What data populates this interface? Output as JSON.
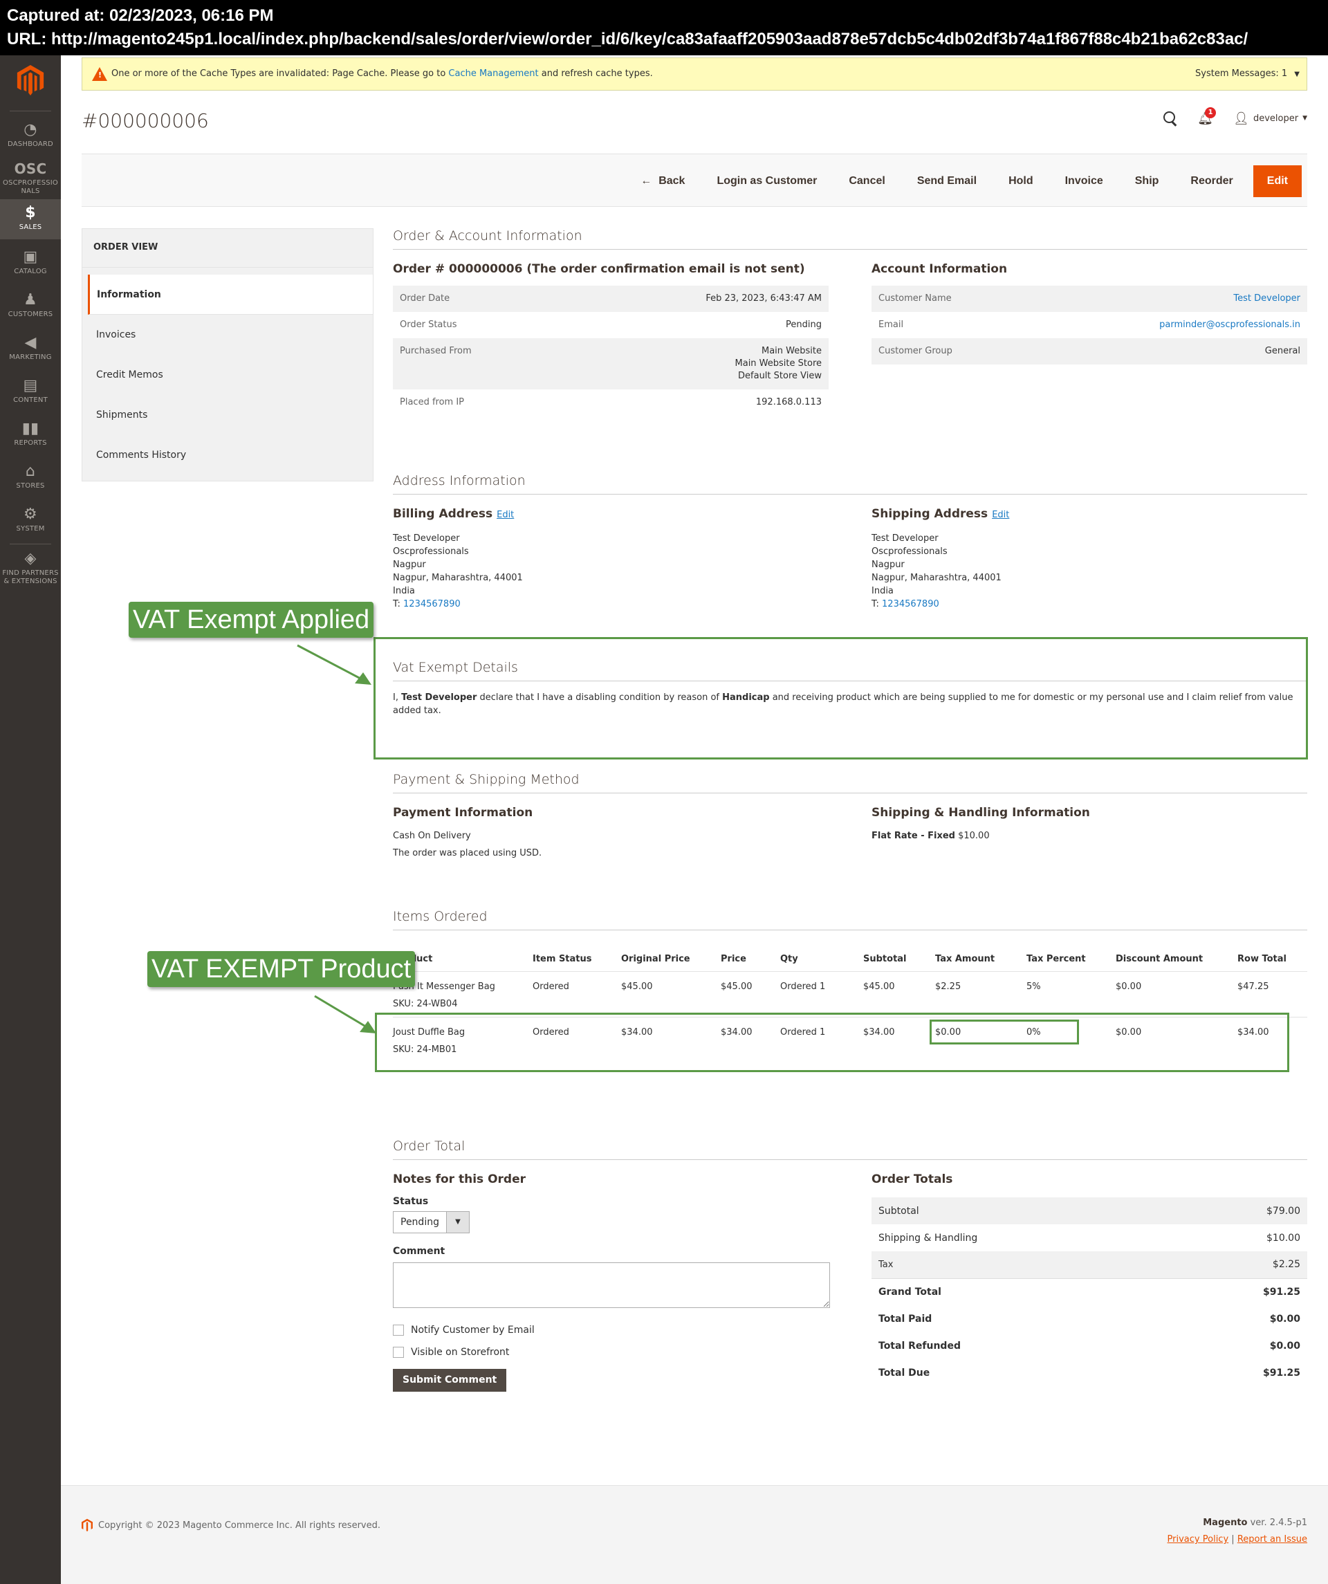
{
  "capture": {
    "captured_at": "Captured at: 02/23/2023, 06:16 PM",
    "url": "URL: http://magento245p1.local/index.php/backend/sales/order/view/order_id/6/key/ca83afaaff205903aad878e57dcb5c4db02df3b74a1f867f88c4b21ba62c83ac/"
  },
  "sidebar": {
    "items": [
      {
        "label": "DASHBOARD",
        "icon": "dashboard-icon"
      },
      {
        "label": "OSCPROFESSIO NALS",
        "icon": "osc-logo-icon"
      },
      {
        "label": "SALES",
        "icon": "dollar-icon",
        "active": true
      },
      {
        "label": "CATALOG",
        "icon": "box-icon"
      },
      {
        "label": "CUSTOMERS",
        "icon": "person-icon"
      },
      {
        "label": "MARKETING",
        "icon": "megaphone-icon"
      },
      {
        "label": "CONTENT",
        "icon": "layout-icon"
      },
      {
        "label": "REPORTS",
        "icon": "bar-chart-icon"
      },
      {
        "label": "STORES",
        "icon": "store-icon"
      },
      {
        "label": "SYSTEM",
        "icon": "gear-icon"
      },
      {
        "label": "FIND PARTNERS & EXTENSIONS",
        "icon": "lego-icon"
      }
    ]
  },
  "notice": {
    "text_before": "One or more of the Cache Types are invalidated: Page Cache. Please go to ",
    "link": "Cache Management",
    "text_after": " and refresh cache types.",
    "system_messages": "System Messages: 1"
  },
  "header": {
    "title": "#000000006",
    "notification_count": "1",
    "user": "developer"
  },
  "actions": {
    "back": "Back",
    "login_as_customer": "Login as Customer",
    "cancel": "Cancel",
    "send_email": "Send Email",
    "hold": "Hold",
    "invoice": "Invoice",
    "ship": "Ship",
    "reorder": "Reorder",
    "edit": "Edit"
  },
  "tabs": {
    "title": "ORDER VIEW",
    "items": [
      "Information",
      "Invoices",
      "Credit Memos",
      "Shipments",
      "Comments History"
    ]
  },
  "order_account": {
    "section_title": "Order & Account Information",
    "order_heading": "Order # 000000006 (The order confirmation email is not sent)",
    "order_rows": [
      {
        "label": "Order Date",
        "value": "Feb 23, 2023, 6:43:47 AM"
      },
      {
        "label": "Order Status",
        "value": "Pending"
      },
      {
        "label": "Purchased From",
        "value": [
          "Main Website",
          "Main Website Store",
          "Default Store View"
        ]
      },
      {
        "label": "Placed from IP",
        "value": "192.168.0.113"
      }
    ],
    "account_heading": "Account Information",
    "account_rows": [
      {
        "label": "Customer Name",
        "value": "Test Developer"
      },
      {
        "label": "Email",
        "value": "parminder@oscprofessionals.in"
      },
      {
        "label": "Customer Group",
        "value": "General"
      }
    ]
  },
  "address": {
    "section_title": "Address Information",
    "edit_label": "Edit",
    "billing": {
      "title": "Billing Address",
      "lines": [
        "Test Developer",
        "Oscprofessionals",
        "Nagpur",
        "Nagpur, Maharashtra, 44001",
        "India"
      ],
      "phone_prefix": "T: ",
      "phone": "1234567890"
    },
    "shipping": {
      "title": "Shipping Address",
      "lines": [
        "Test Developer",
        "Oscprofessionals",
        "Nagpur",
        "Nagpur, Maharashtra, 44001",
        "India"
      ],
      "phone_prefix": "T: ",
      "phone": "1234567890"
    }
  },
  "vat": {
    "section_title": "Vat Exempt Details",
    "text_1": "I, ",
    "name": "Test Developer",
    "text_2": " declare that I have a disabling condition by reason of ",
    "reason": "Handicap",
    "text_3": " and receiving product which are being supplied to me for domestic or my personal use and I claim relief from value added tax."
  },
  "payment_shipping": {
    "section_title": "Payment & Shipping Method",
    "payment_title": "Payment Information",
    "payment_method": "Cash On Delivery",
    "currency_note": "The order was placed using USD.",
    "shipping_title": "Shipping & Handling Information",
    "shipping_method": "Flat Rate - Fixed",
    "shipping_price": "$10.00"
  },
  "items": {
    "section_title": "Items Ordered",
    "columns": [
      "Product",
      "Item Status",
      "Original Price",
      "Price",
      "Qty",
      "Subtotal",
      "Tax Amount",
      "Tax Percent",
      "Discount Amount",
      "Row Total"
    ],
    "rows": [
      {
        "product": "Push It Messenger Bag",
        "sku": "SKU: 24-WB04",
        "status": "Ordered",
        "original_price": "$45.00",
        "price": "$45.00",
        "qty": "Ordered 1",
        "subtotal": "$45.00",
        "tax_amount": "$2.25",
        "tax_percent": "5%",
        "discount": "$0.00",
        "row_total": "$47.25"
      },
      {
        "product": "Joust Duffle Bag",
        "sku": "SKU: 24-MB01",
        "status": "Ordered",
        "original_price": "$34.00",
        "price": "$34.00",
        "qty": "Ordered 1",
        "subtotal": "$34.00",
        "tax_amount": "$0.00",
        "tax_percent": "0%",
        "discount": "$0.00",
        "row_total": "$34.00"
      }
    ]
  },
  "order_total": {
    "section_title": "Order Total",
    "notes_title": "Notes for this Order",
    "status_label": "Status",
    "status_value": "Pending",
    "comment_label": "Comment",
    "comment_value": "",
    "notify_label": "Notify Customer by Email",
    "visible_label": "Visible on Storefront",
    "submit_label": "Submit Comment",
    "totals_title": "Order Totals",
    "totals": [
      {
        "label": "Subtotal",
        "value": "$79.00"
      },
      {
        "label": "Shipping & Handling",
        "value": "$10.00"
      },
      {
        "label": "Tax",
        "value": "$2.25"
      },
      {
        "label": "Grand Total",
        "value": "$91.25"
      },
      {
        "label": "Total Paid",
        "value": "$0.00"
      },
      {
        "label": "Total Refunded",
        "value": "$0.00"
      },
      {
        "label": "Total Due",
        "value": "$91.25"
      }
    ]
  },
  "annotations": {
    "vat_applied": "VAT Exempt Applied",
    "vat_product": "VAT EXEMPT Product",
    "color": "#5b9a47"
  },
  "footer": {
    "copyright": "Copyright © 2023 Magento Commerce Inc. All rights reserved.",
    "brand": "Magento",
    "version": " ver. 2.4.5-p1",
    "privacy": "Privacy Policy",
    "separator": " | ",
    "report": "Report an Issue"
  },
  "colors": {
    "accent": "#eb5202",
    "sidebar": "#373330",
    "link": "#1979c3"
  }
}
